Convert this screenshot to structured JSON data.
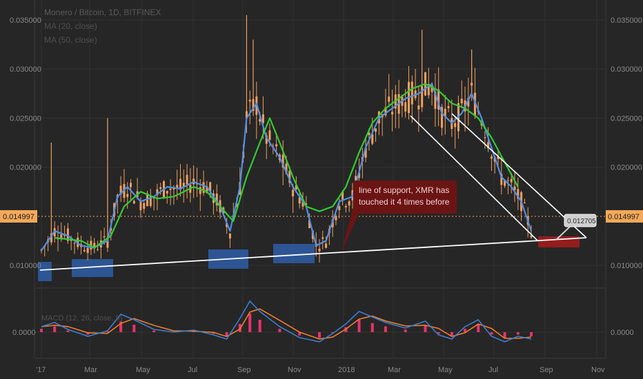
{
  "header": {
    "title": "Monero / Bitcoin, 1D, BITFINEX",
    "ma1": "MA (20, close)",
    "ma2": "MA (50, close)"
  },
  "macd_label": "MACD (12, 26, close, 9)",
  "annotation": {
    "line1": "line of support, XMR has",
    "line2": "touched it 4 times before"
  },
  "price_label": "0.014997",
  "price_label_right": "0.014997",
  "callout_value": "0.012705",
  "macd_zero_left": "0.0000",
  "macd_zero_right": "0.0000",
  "colors": {
    "background": "#262626",
    "grid": "#333333",
    "candle": "#f0a060",
    "ma20": "#4f8fe8",
    "ma50": "#33cc33",
    "support": "#ffffff",
    "macd_line": "#3a7fd5",
    "signal_line": "#f07d2a",
    "histogram": "#e8336b",
    "annotation_bg": "#6b1414",
    "price_tag": "#f4a95a",
    "highlight_blue": "#2f5ea8",
    "highlight_red": "#a81c1c"
  },
  "chart_data": {
    "type": "line",
    "title": "Monero / Bitcoin, 1D, BITFINEX",
    "x_ticks": [
      "'17",
      "Mar",
      "May",
      "Jul",
      "Sep",
      "Nov",
      "2018",
      "Mar",
      "May",
      "Jul",
      "Sep",
      "Nov"
    ],
    "y_ticks": [
      "0.035000",
      "0.030000",
      "0.025000",
      "0.020000",
      "0.010000"
    ],
    "ylim": [
      0.008,
      0.036
    ],
    "current_price": 0.014997,
    "series": [
      {
        "name": "MA (20, close)",
        "points": [
          [
            0,
            0.0115
          ],
          [
            4,
            0.0135
          ],
          [
            8,
            0.013
          ],
          [
            12,
            0.012
          ],
          [
            16,
            0.0118
          ],
          [
            20,
            0.0125
          ],
          [
            23,
            0.017
          ],
          [
            26,
            0.018
          ],
          [
            30,
            0.0165
          ],
          [
            34,
            0.017
          ],
          [
            38,
            0.018
          ],
          [
            42,
            0.0178
          ],
          [
            46,
            0.0185
          ],
          [
            50,
            0.018
          ],
          [
            54,
            0.016
          ],
          [
            57,
            0.0135
          ],
          [
            60,
            0.018
          ],
          [
            62,
            0.025
          ],
          [
            65,
            0.0265
          ],
          [
            68,
            0.023
          ],
          [
            72,
            0.021
          ],
          [
            76,
            0.018
          ],
          [
            80,
            0.016
          ],
          [
            83,
            0.012
          ],
          [
            86,
            0.0125
          ],
          [
            90,
            0.0165
          ],
          [
            94,
            0.017
          ],
          [
            98,
            0.022
          ],
          [
            102,
            0.025
          ],
          [
            106,
            0.026
          ],
          [
            110,
            0.027
          ],
          [
            114,
            0.0275
          ],
          [
            118,
            0.0285
          ],
          [
            121,
            0.0255
          ],
          [
            124,
            0.0245
          ],
          [
            127,
            0.0255
          ],
          [
            130,
            0.0275
          ],
          [
            133,
            0.025
          ],
          [
            136,
            0.022
          ],
          [
            139,
            0.019
          ],
          [
            142,
            0.018
          ],
          [
            145,
            0.0165
          ],
          [
            148,
            0.0135
          ]
        ]
      },
      {
        "name": "MA (50, close)",
        "points": [
          [
            4,
            0.0128
          ],
          [
            12,
            0.0125
          ],
          [
            16,
            0.0118
          ],
          [
            21,
            0.013
          ],
          [
            25,
            0.016
          ],
          [
            30,
            0.0175
          ],
          [
            35,
            0.0168
          ],
          [
            40,
            0.017
          ],
          [
            46,
            0.018
          ],
          [
            50,
            0.0175
          ],
          [
            54,
            0.016
          ],
          [
            58,
            0.0145
          ],
          [
            62,
            0.019
          ],
          [
            66,
            0.0225
          ],
          [
            69,
            0.025
          ],
          [
            72,
            0.0225
          ],
          [
            76,
            0.019
          ],
          [
            80,
            0.016
          ],
          [
            84,
            0.0155
          ],
          [
            88,
            0.016
          ],
          [
            92,
            0.018
          ],
          [
            96,
            0.0215
          ],
          [
            100,
            0.0245
          ],
          [
            104,
            0.026
          ],
          [
            108,
            0.027
          ],
          [
            112,
            0.028
          ],
          [
            116,
            0.0285
          ],
          [
            120,
            0.0278
          ],
          [
            124,
            0.0265
          ],
          [
            128,
            0.026
          ],
          [
            132,
            0.025
          ],
          [
            136,
            0.023
          ],
          [
            140,
            0.0205
          ],
          [
            144,
            0.018
          ]
        ]
      }
    ],
    "support_line": {
      "from": [
        0,
        0.0095
      ],
      "to": [
        151,
        0.0128
      ]
    },
    "annotation": "line of support, XMR has touched it 4 times before"
  }
}
